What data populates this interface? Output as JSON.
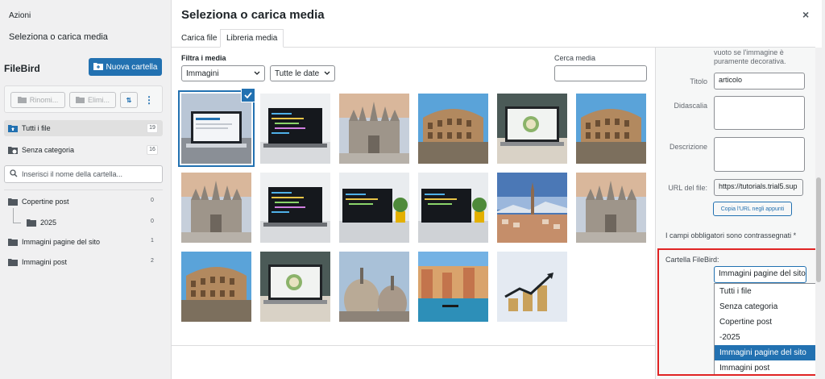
{
  "sidebar": {
    "azioni": "Azioni",
    "menu_title": "Seleziona o carica media",
    "filebird_title": "FileBird",
    "new_folder_label": "Nuova cartella",
    "rename_label": "Rinomi...",
    "delete_label": "Elimi...",
    "all_files": {
      "label": "Tutti i file",
      "count": "19"
    },
    "uncategorized": {
      "label": "Senza categoria",
      "count": "16"
    },
    "search_placeholder": "Inserisci il nome della cartella...",
    "folders": [
      {
        "label": "Copertine post",
        "count": "0"
      },
      {
        "label": "2025",
        "count": "0"
      },
      {
        "label": "Immagini pagine del sito",
        "count": "1"
      },
      {
        "label": "Immagini post",
        "count": "2"
      }
    ]
  },
  "modal": {
    "title": "Seleziona o carica media",
    "close": "×",
    "tabs": [
      "Carica file",
      "Libreria media"
    ],
    "filter_label": "Filtra i media",
    "type_filter": "Immagini",
    "date_filter": "Tutte le date",
    "search_label": "Cerca media"
  },
  "media": [
    {
      "kind": "laptop"
    },
    {
      "kind": "code"
    },
    {
      "kind": "duomo"
    },
    {
      "kind": "colosseum"
    },
    {
      "kind": "laptop-food"
    },
    {
      "kind": "colosseum"
    },
    {
      "kind": "duomo"
    },
    {
      "kind": "code"
    },
    {
      "kind": "laptop-plant"
    },
    {
      "kind": "laptop-plant"
    },
    {
      "kind": "turin"
    },
    {
      "kind": "duomo"
    },
    {
      "kind": "colosseum"
    },
    {
      "kind": "laptop-food"
    },
    {
      "kind": "domes"
    },
    {
      "kind": "venice"
    },
    {
      "kind": "growth"
    }
  ],
  "details": {
    "alt_hint": "vuoto se l'immagine è puramente decorativa.",
    "title_label": "Titolo",
    "title_value": "articolo",
    "caption_label": "Didascalia",
    "description_label": "Descrizione",
    "url_label": "URL del file:",
    "url_value": "https://tutorials.trial5.sup",
    "copy_url": "Copia l'URL negli appunti",
    "required_note": "I campi obbligatori sono contrassegnati *",
    "folder_label": "Cartella FileBird:",
    "folder_selected": "Immagini pagine del sito",
    "folder_options": [
      "Tutti i file",
      "Senza categoria",
      "Copertine post",
      "-2025",
      "Immagini pagine del sito",
      "Immagini post"
    ],
    "highlighted_index": 4
  },
  "colors": {
    "accent": "#2271b1",
    "highlight": "#e02424"
  }
}
